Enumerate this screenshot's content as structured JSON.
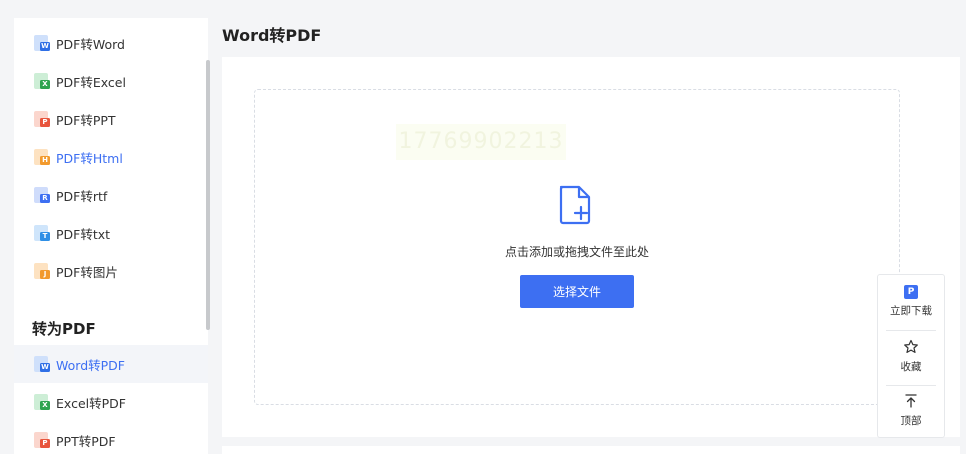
{
  "sidebar": {
    "items": [
      {
        "label": "PDF转Word",
        "tag": "W",
        "color": "#2f6fe6",
        "sheet": "#cfe0fb"
      },
      {
        "label": "PDF转Excel",
        "tag": "X",
        "color": "#2ea44f",
        "sheet": "#cdeed6"
      },
      {
        "label": "PDF转PPT",
        "tag": "P",
        "color": "#e8553d",
        "sheet": "#fbd6cd"
      },
      {
        "label": "PDF转Html",
        "tag": "H",
        "color": "#f29a2e",
        "sheet": "#fde2c1"
      },
      {
        "label": "PDF转rtf",
        "tag": "R",
        "color": "#3d6ff2",
        "sheet": "#cfdcfb"
      },
      {
        "label": "PDF转txt",
        "tag": "T",
        "color": "#2f8fe6",
        "sheet": "#cfe5fb"
      },
      {
        "label": "PDF转图片",
        "tag": "J",
        "color": "#f29a2e",
        "sheet": "#fde2c1"
      }
    ],
    "section_title": "转为PDF",
    "section_items": [
      {
        "label": "Word转PDF",
        "tag": "W",
        "color": "#2f6fe6",
        "sheet": "#cfe0fb"
      },
      {
        "label": "Excel转PDF",
        "tag": "X",
        "color": "#2ea44f",
        "sheet": "#cdeed6"
      },
      {
        "label": "PPT转PDF",
        "tag": "P",
        "color": "#e8553d",
        "sheet": "#fbd6cd"
      }
    ]
  },
  "main": {
    "title": "Word转PDF",
    "watermark": "17769902213",
    "drop_hint": "点击添加或拖拽文件至此处",
    "choose_button": "选择文件"
  },
  "float_tools": {
    "download": "立即下载",
    "download_badge": "P",
    "favorite": "收藏",
    "top": "顶部"
  },
  "colors": {
    "accent": "#3d6ff2"
  }
}
